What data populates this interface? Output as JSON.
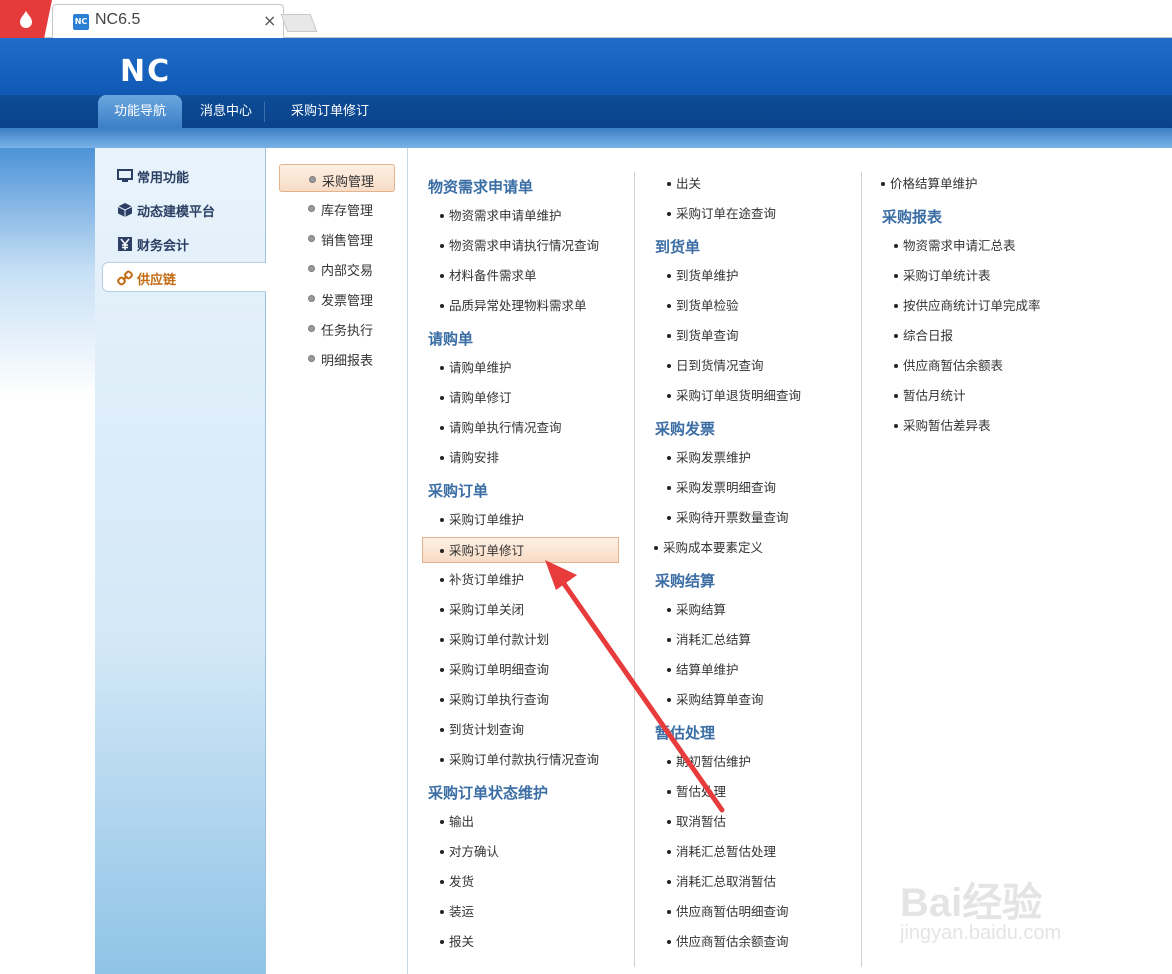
{
  "browser": {
    "tab_title": "NC6.5",
    "tab_close": "×"
  },
  "app": {
    "logo": "NC",
    "tabs": [
      "功能导航",
      "消息中心",
      "采购订单修订"
    ]
  },
  "sidebar": {
    "items": [
      {
        "label": "常用功能",
        "icon": "monitor-icon"
      },
      {
        "label": "动态建模平台",
        "icon": "cube-icon"
      },
      {
        "label": "财务会计",
        "icon": "yen-icon"
      },
      {
        "label": "供应链",
        "icon": "link-icon"
      }
    ]
  },
  "categories": [
    "采购管理",
    "库存管理",
    "销售管理",
    "内部交易",
    "发票管理",
    "任务执行",
    "明细报表"
  ],
  "col1": {
    "g1": "物资需求申请单",
    "g1_items": [
      "物资需求申请单维护",
      "物资需求申请执行情况查询",
      "材料备件需求单",
      "品质异常处理物料需求单"
    ],
    "g2": "请购单",
    "g2_items": [
      "请购单维护",
      "请购单修订",
      "请购单执行情况查询",
      "请购安排"
    ],
    "g3": "采购订单",
    "g3_items": [
      "采购订单维护",
      "采购订单修订",
      "补货订单维护",
      "采购订单关闭",
      "采购订单付款计划",
      "采购订单明细查询",
      "采购订单执行查询",
      "到货计划查询",
      "采购订单付款执行情况查询"
    ],
    "g4": "采购订单状态维护",
    "g4_items": [
      "输出",
      "对方确认",
      "发货",
      "装运",
      "报关"
    ]
  },
  "col2": {
    "top_items": [
      "出关",
      "采购订单在途查询"
    ],
    "g1": "到货单",
    "g1_items": [
      "到货单维护",
      "到货单检验",
      "到货单查询",
      "日到货情况查询",
      "采购订单退货明细查询"
    ],
    "g2": "采购发票",
    "g2_items": [
      "采购发票维护",
      "采购发票明细查询",
      "采购待开票数量查询"
    ],
    "standalone": "采购成本要素定义",
    "g3": "采购结算",
    "g3_items": [
      "采购结算",
      "消耗汇总结算",
      "结算单维护",
      "采购结算单查询"
    ],
    "g4": "暂估处理",
    "g4_items": [
      "期初暂估维护",
      "暂估处理",
      "取消暂估",
      "消耗汇总暂估处理",
      "消耗汇总取消暂估",
      "供应商暂估明细查询",
      "供应商暂估余额查询"
    ]
  },
  "col3": {
    "top_items": [
      "价格结算单维护"
    ],
    "g1": "采购报表",
    "g1_items": [
      "物资需求申请汇总表",
      "采购订单统计表",
      "按供应商统计订单完成率",
      "综合日报",
      "供应商暂估余额表",
      "暂估月统计",
      "采购暂估差异表"
    ]
  },
  "watermark": {
    "line1": "Bai经验",
    "line2": "jingyan.baidu.com"
  },
  "colors": {
    "header_blue": "#0f58b4",
    "group_title": "#3b6ea5",
    "active_orange": "#c26b12",
    "arrow_red": "#e83c3c"
  }
}
